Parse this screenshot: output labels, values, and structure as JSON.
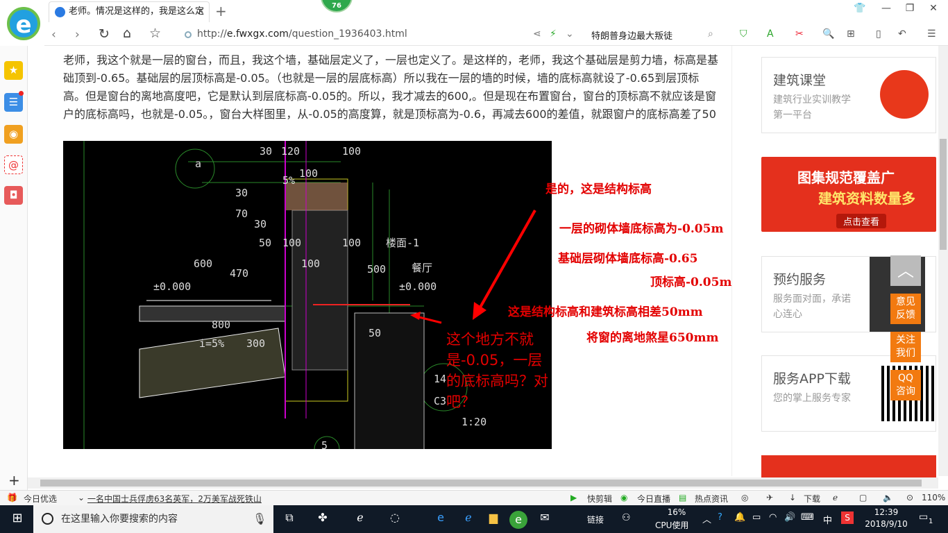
{
  "browser": {
    "tab_title": "老师。情况是这样的，我是这么定",
    "badge": "76",
    "url_host": "e.fwxgx.com",
    "url_path": "/question_1936403.html",
    "url_prefix": "http://",
    "hot_search": "特朗普身边最大叛徒",
    "zoom": "110%"
  },
  "question": {
    "text": "老师，我这个就是一层的窗台，而且，我这个墙，基础层定义了，一层也定义了。是这样的，老师，我这个基础层是剪力墙，标高是基础顶到-0.65。基础层的层顶标高是-0.05。（也就是一层的层底标高）所以我在一层的墙的时候，墙的底标高就设了-0.65到层顶标高。但是窗台的离地高度吧，它是默认到层底标高-0.05的。所以，我才减去的600,。但是现在布置窗台，窗台的顶标高不就应该是窗户的底标高吗，也就是-0.05。，窗台大样图里，从-0.05的高度算，就是顶标高为-0.6，再减去600的差值，就跟窗户的底标高差了50"
  },
  "drawing": {
    "dims": [
      "30",
      "120",
      "100",
      "100",
      "5%",
      "30",
      "70",
      "30",
      "50",
      "100",
      "100",
      "100",
      "600",
      "470",
      "500",
      "800",
      "i=5%",
      "300",
      "50",
      "±0.000",
      "±0.000",
      "楼面-1",
      "餐厅",
      "14",
      "C3",
      "1:20",
      "a",
      "5"
    ],
    "annotations": {
      "a1": "是的，这是结构标高",
      "a2": "一层的砌体墙底标高为-0.05m",
      "a3": "基础层砌体墙底标高-0.65",
      "a4": "顶标高-0.05m",
      "a5": "这是结构标高和建筑标高相差50mm",
      "a6": "将窗的离地煞星650mm"
    },
    "bubble": "这个地方不就是-0.05，一层的底标高吗？对吧？"
  },
  "right": {
    "card1_title": "建筑课堂",
    "card1_desc": "建筑行业实训教学第一平台",
    "banner_line1": "图集规范覆盖广",
    "banner_line2": "建筑资料数量多",
    "banner_btn": "点击查看",
    "card2_title": "预约服务",
    "card2_desc": "服务面对面，承诺心连心",
    "card3_title": "服务APP下载",
    "card3_desc": "您的掌上服务专家",
    "float_feedback": "意见反馈",
    "float_follow": "关注我们",
    "float_qq": "QQ咨询"
  },
  "status": {
    "today": "今日优选",
    "news": "一名中国士兵俘虏63名英军，2万美军战死铁山",
    "kuaijian": "快剪辑",
    "live": "今日直播",
    "hot": "热点资讯",
    "download": "下载"
  },
  "taskbar": {
    "search_placeholder": "在这里输入你要搜索的内容",
    "link": "链接",
    "cpu_pct": "16%",
    "cpu_label": "CPU使用",
    "ime": "中",
    "time": "12:39",
    "date": "2018/9/10",
    "notif": "1"
  },
  "colors": {
    "annotation_red": "#e30000",
    "accent_orange": "#f27a10",
    "taskbar": "#101a27"
  }
}
